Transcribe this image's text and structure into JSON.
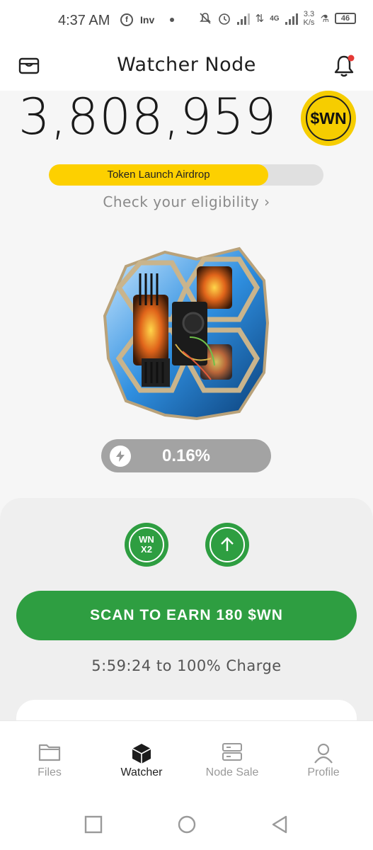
{
  "status_bar": {
    "time": "4:37 AM",
    "app_label": "Inv",
    "network": "4G",
    "speed_value": "3.3",
    "speed_unit": "K/s",
    "battery": "46"
  },
  "header": {
    "title": "Watcher Node",
    "wallet_icon": "wallet-icon",
    "bell_icon": "bell-icon",
    "has_notification": true
  },
  "balance": {
    "amount": "3,808,959",
    "token_badge": "$WN"
  },
  "airdrop": {
    "label": "Token Launch Airdrop",
    "progress_fraction": 0.8
  },
  "eligibility": {
    "label": "Check your eligibility ›"
  },
  "boost": {
    "value": "0.16%",
    "icon": "bolt-icon"
  },
  "actions": {
    "multiplier_top": "WN",
    "multiplier_bottom": "X2",
    "upgrade_icon": "arrow-up-icon",
    "scan_label": "SCAN TO EARN 180 $WN",
    "charge_status": "5:59:24 to 100% Charge"
  },
  "bottom_nav": {
    "items": [
      {
        "label": "Files",
        "icon": "folder-icon",
        "active": false
      },
      {
        "label": "Watcher",
        "icon": "cube-icon",
        "active": true
      },
      {
        "label": "Node Sale",
        "icon": "server-icon",
        "active": false
      },
      {
        "label": "Profile",
        "icon": "user-icon",
        "active": false
      }
    ]
  },
  "colors": {
    "accent_green": "#2e9e41",
    "token_yellow": "#fdd000",
    "background": "#f6f6f6"
  }
}
